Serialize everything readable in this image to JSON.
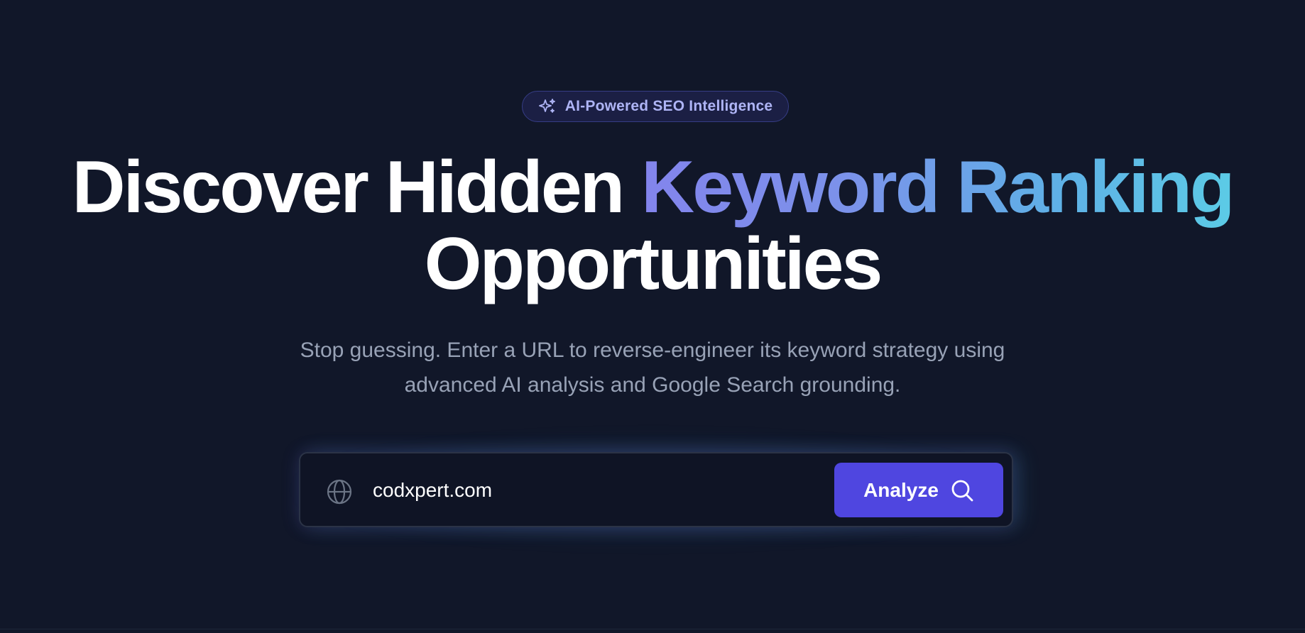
{
  "badge": {
    "icon": "sparkles-icon",
    "label": "AI-Powered SEO Intelligence"
  },
  "headline": {
    "part1": "Discover Hidden ",
    "highlight": "Keyword Ranking",
    "part2": "Opportunities"
  },
  "subtitle": {
    "line1": "Stop guessing. Enter a URL to reverse-engineer its keyword strategy using",
    "line2": "advanced AI analysis and Google Search grounding."
  },
  "search": {
    "icon": "globe-icon",
    "value": "codxpert.com",
    "button_label": "Analyze",
    "button_icon": "search-icon"
  },
  "colors": {
    "background": "#111729",
    "accent": "#4f46e0",
    "gradient_start": "#8384ec",
    "gradient_end": "#5ccbe6",
    "badge_text": "#aeb4f5",
    "subtitle_text": "#98a2b6"
  }
}
